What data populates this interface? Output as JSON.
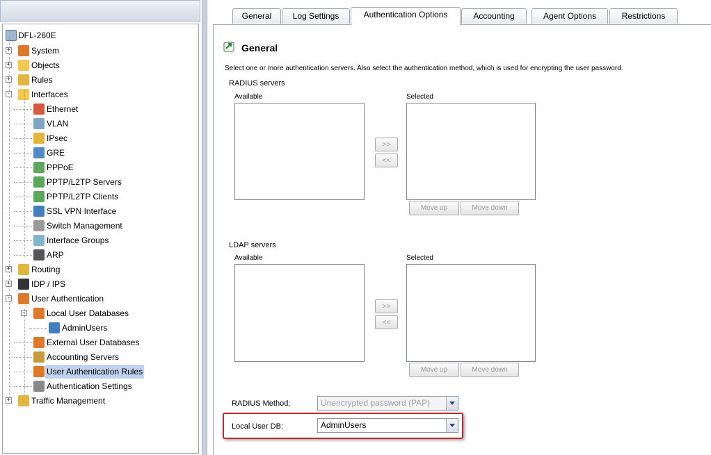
{
  "tree": {
    "root": "DFL-260E",
    "items": [
      {
        "label": "System",
        "icon": "system-icon",
        "color": "#e0782a",
        "expander": "+"
      },
      {
        "label": "Objects",
        "icon": "folder-icon",
        "color": "#f2c94c",
        "expander": "+"
      },
      {
        "label": "Rules",
        "icon": "rules-icon",
        "color": "#e3b53c",
        "expander": "+"
      },
      {
        "label": "Interfaces",
        "icon": "folder-icon",
        "color": "#f2c94c",
        "expander": "-"
      },
      {
        "label": "Ethernet",
        "icon": "ethernet-icon",
        "color": "#d9573a"
      },
      {
        "label": "VLAN",
        "icon": "vlan-icon",
        "color": "#7aa7c7"
      },
      {
        "label": "IPsec",
        "icon": "lock-icon",
        "color": "#e5b43a"
      },
      {
        "label": "GRE",
        "icon": "gre-icon",
        "color": "#4f8bc9"
      },
      {
        "label": "PPPoE",
        "icon": "pppoe-icon",
        "color": "#5aa85a"
      },
      {
        "label": "PPTP/L2TP Servers",
        "icon": "pptp-server-icon",
        "color": "#5aa85a"
      },
      {
        "label": "PPTP/L2TP Clients",
        "icon": "pptp-client-icon",
        "color": "#5aa85a"
      },
      {
        "label": "SSL VPN Interface",
        "icon": "ssl-vpn-icon",
        "color": "#3f7fbf"
      },
      {
        "label": "Switch Management",
        "icon": "switch-icon",
        "color": "#9a9a9a"
      },
      {
        "label": "Interface Groups",
        "icon": "interface-groups-icon",
        "color": "#7fb4c9"
      },
      {
        "label": "ARP",
        "icon": "arp-icon",
        "color": "#555555"
      },
      {
        "label": "Routing",
        "icon": "routing-icon",
        "color": "#e3b53c",
        "expander": "+"
      },
      {
        "label": "IDP / IPS",
        "icon": "idp-icon",
        "color": "#333333",
        "expander": "+"
      },
      {
        "label": "User Authentication",
        "icon": "user-auth-icon",
        "color": "#e0782a",
        "expander": "-"
      },
      {
        "label": "Local User Databases",
        "icon": "user-db-icon",
        "color": "#e0782a",
        "expander": "-"
      },
      {
        "label": "AdminUsers",
        "icon": "user-db-icon",
        "color": "#3f7fbf"
      },
      {
        "label": "External User Databases",
        "icon": "external-db-icon",
        "color": "#e0782a"
      },
      {
        "label": "Accounting Servers",
        "icon": "accounting-icon",
        "color": "#c99a3a"
      },
      {
        "label": "User Authentication Rules",
        "icon": "auth-rules-icon",
        "color": "#e0782a"
      },
      {
        "label": "Authentication Settings",
        "icon": "auth-settings-icon",
        "color": "#8a8a8a"
      },
      {
        "label": "Traffic Management",
        "icon": "traffic-icon",
        "color": "#e3b53c",
        "expander": "+"
      }
    ]
  },
  "tabs": [
    "General",
    "Log Settings",
    "Authentication Options",
    "Accounting",
    "Agent Options",
    "Restrictions"
  ],
  "active_tab": "Authentication Options",
  "section": {
    "title": "General",
    "description": "Select one or more authentication servers. Also select the authentication method, which is used for encrypting the user password."
  },
  "radius": {
    "heading": "RADIUS servers",
    "available_label": "Available",
    "selected_label": "Selected",
    "add_btn": ">>",
    "remove_btn": "<<",
    "move_up": "Move up",
    "move_down": "Move down"
  },
  "ldap": {
    "heading": "LDAP servers",
    "available_label": "Available",
    "selected_label": "Selected",
    "add_btn": ">>",
    "remove_btn": "<<",
    "move_up": "Move up",
    "move_down": "Move down"
  },
  "radius_method": {
    "label": "RADIUS Method:",
    "value": "Unencrypted password (PAP)"
  },
  "local_user_db": {
    "label": "Local User DB:",
    "value": "AdminUsers"
  },
  "colors": {
    "highlight": "#c0282e",
    "selection": "#bfd3ee"
  }
}
